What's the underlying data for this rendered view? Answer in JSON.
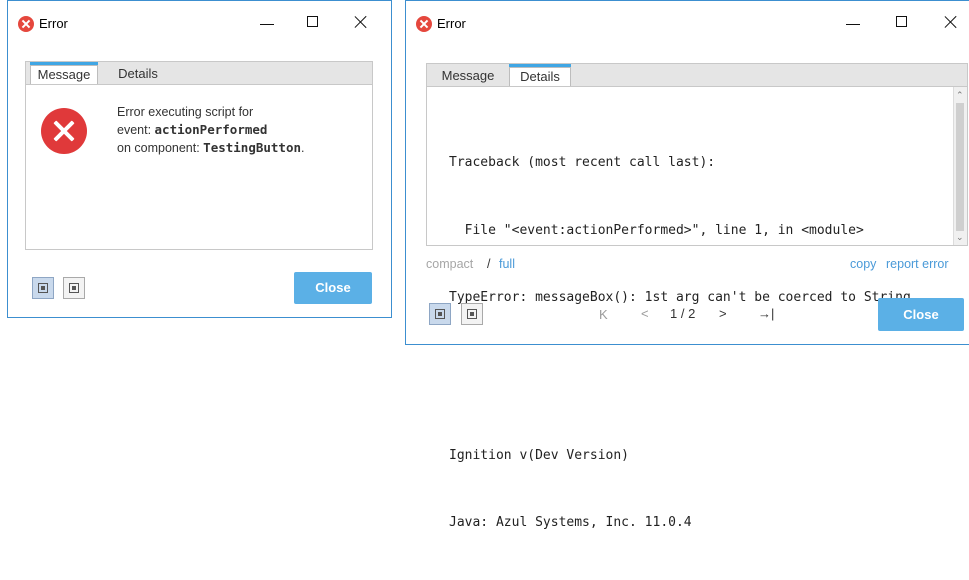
{
  "left": {
    "title": "Error",
    "tabs": [
      "Message",
      "Details"
    ],
    "message": {
      "line1": "Error executing script for",
      "line2_prefix": "event: ",
      "line2_event": "actionPerformed",
      "line3_prefix": "on component: ",
      "line3_component": "TestingButton",
      "line3_suffix": "."
    },
    "close_label": "Close"
  },
  "right": {
    "title": "Error",
    "tabs": [
      "Message",
      "Details"
    ],
    "details_lines": [
      "Traceback (most recent call last):",
      "  File \"<event:actionPerformed>\", line 1, in <module>",
      "TypeError: messageBox(): 1st arg can't be coerced to String",
      "",
      "",
      "Ignition v(Dev Version)",
      "Java: Azul Systems, Inc. 11.0.4"
    ],
    "compact_label": "compact",
    "separator": "/",
    "full_label": "full",
    "copy_label": "copy",
    "report_label": "report error",
    "pager": {
      "first": "K",
      "prev": "<",
      "status": "1 / 2",
      "next": ">",
      "last": "→|"
    },
    "close_label": "Close"
  },
  "icons": [
    "error-icon",
    "minimize-icon",
    "maximize-icon",
    "close-icon",
    "compact-view-icon",
    "expand-view-icon"
  ]
}
